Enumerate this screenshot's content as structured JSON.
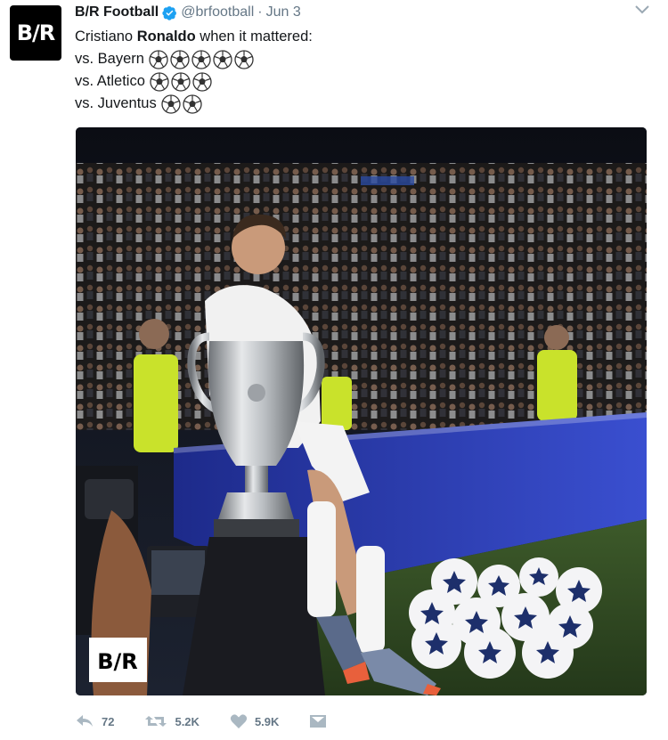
{
  "tweet": {
    "avatar_text": "B/R",
    "author_name": "B/R Football",
    "handle": "@brfootball",
    "separator": "·",
    "date": "Jun 3",
    "lines": {
      "line1_prefix": "Cristiano ",
      "line1_bold": "Ronaldo",
      "line1_suffix": " when it mattered:",
      "line2": "vs. Bayern",
      "line2_balls": 5,
      "line3": "vs. Atletico",
      "line3_balls": 3,
      "line4": "vs. Juventus",
      "line4_balls": 2
    },
    "image": {
      "watermark": "B/R"
    },
    "actions": {
      "reply_count": "72",
      "retweet_count": "5.2K",
      "like_count": "5.9K"
    },
    "colors": {
      "verified": "#1da1f2",
      "muted": "#657786",
      "text": "#14171a"
    }
  }
}
